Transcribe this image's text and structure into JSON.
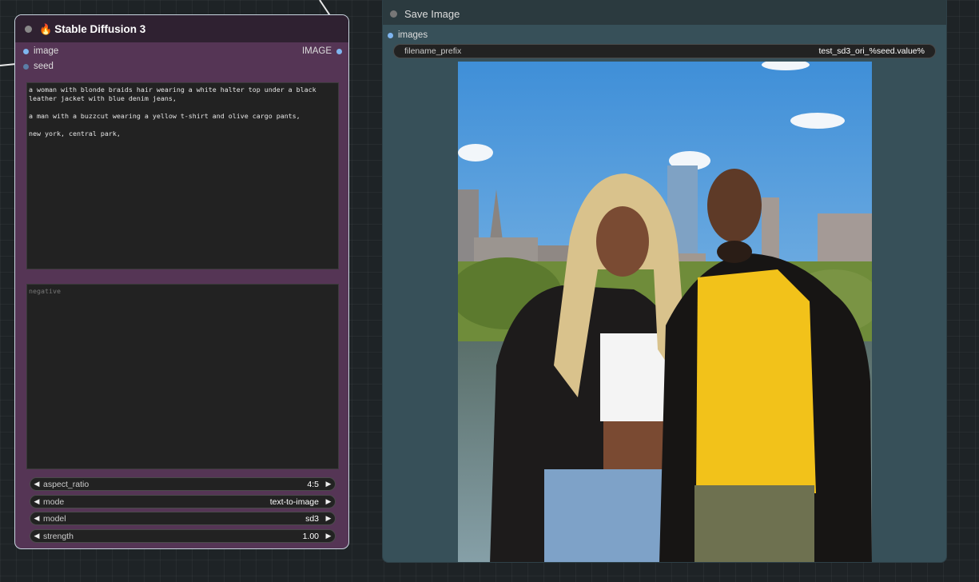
{
  "sd3_node": {
    "title": "Stable Diffusion 3",
    "inputs": {
      "image": "image",
      "seed": "seed"
    },
    "output": "IMAGE",
    "prompt": "a woman with blonde braids hair wearing a white halter top under a black leather jacket with blue denim jeans,\n\na man with a buzzcut wearing a yellow t-shirt and olive cargo pants,\n\nnew york, central park,",
    "negative_placeholder": "negative",
    "widgets": {
      "aspect_ratio": {
        "label": "aspect_ratio",
        "value": "4:5"
      },
      "mode": {
        "label": "mode",
        "value": "text-to-image"
      },
      "model": {
        "label": "model",
        "value": "sd3"
      },
      "strength": {
        "label": "strength",
        "value": "1.00"
      }
    }
  },
  "save_node": {
    "title": "Save Image",
    "input": "images",
    "filename_prefix": {
      "label": "filename_prefix",
      "value": "test_sd3_ori_%seed.value%"
    }
  },
  "colors": {
    "sd3_body": "#553555",
    "sd3_header": "#2f2131",
    "save_body": "#375059",
    "slot": "#7fb6f0"
  }
}
